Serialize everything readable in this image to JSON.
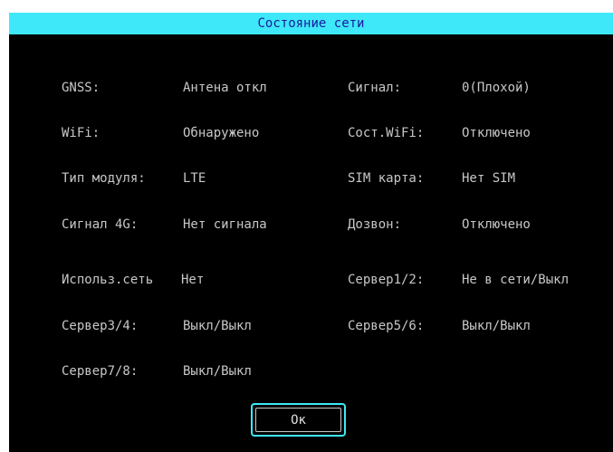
{
  "title": "Состояние сети",
  "rows": [
    {
      "left_label": "GNSS:",
      "left_value": "Антена откл",
      "right_label": "Сигнал:",
      "right_value": "0(Плохой)"
    },
    {
      "left_label": "WiFi:",
      "left_value": "Обнаружено",
      "right_label": "Сост.WiFi:",
      "right_value": "Отключено"
    },
    {
      "left_label": "Тип модуля:",
      "left_value": "LTE",
      "right_label": "SIM карта:",
      "right_value": "Нет SIM"
    },
    {
      "left_label": "Сигнал 4G:",
      "left_value": "Нет сигнала",
      "right_label": "Дозвон:",
      "right_value": "Отключено"
    },
    {
      "left_label": "Использ.сеть",
      "left_value": "Нет",
      "right_label": "Сервер1/2:",
      "right_value": "Не в сети/Выкл"
    },
    {
      "left_label": "Сервер3/4:",
      "left_value": "Выкл/Выкл",
      "right_label": "Сервер5/6:",
      "right_value": "Выкл/Выкл"
    },
    {
      "left_label": "Сервер7/8:",
      "left_value": "Выкл/Выкл"
    }
  ],
  "ok_button": {
    "label": "Ок"
  },
  "colors": {
    "title_bar": "#3ee8f8",
    "title_text": "#1a1aa0",
    "background": "#000000",
    "text": "#c8c8c8",
    "focus_border": "#3ee8f8"
  }
}
